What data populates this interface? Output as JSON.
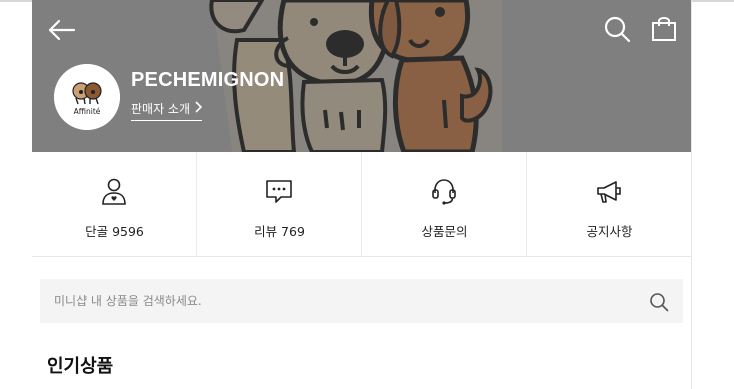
{
  "header": {
    "shop_name": "PECHEMIGNON",
    "seller_link_label": "판매자 소개",
    "logo_text": "Affinité"
  },
  "stats": [
    {
      "icon": "person-heart-icon",
      "label": "단골 9596"
    },
    {
      "icon": "chat-bubble-icon",
      "label": "리뷰 769"
    },
    {
      "icon": "headset-icon",
      "label": "상품문의"
    },
    {
      "icon": "megaphone-icon",
      "label": "공지사항"
    }
  ],
  "search": {
    "placeholder": "미니샵 내 상품을 검색하세요.",
    "value": ""
  },
  "sections": {
    "popular_title": "인기상품"
  },
  "colors": {
    "hero_overlay": "#7f7f7f",
    "dog_brown": "#a8612a",
    "search_bg": "#f4f4f4",
    "text_dark": "#222222"
  }
}
